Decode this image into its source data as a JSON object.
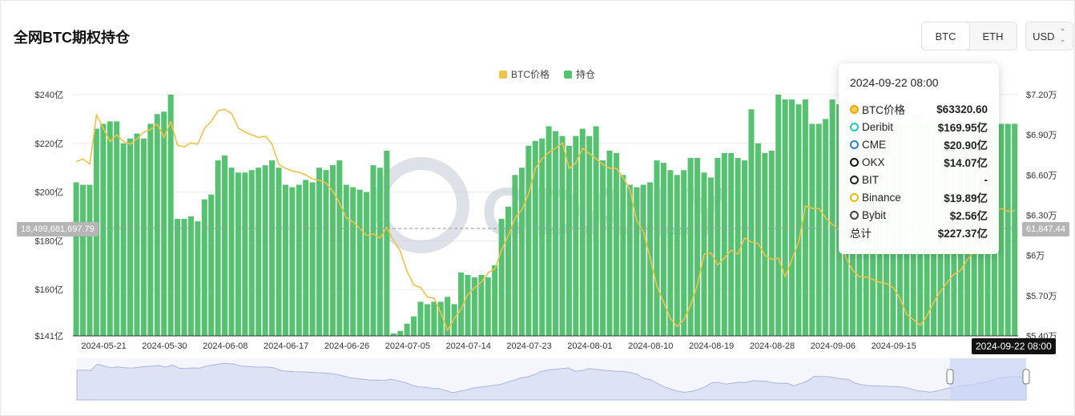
{
  "header": {
    "title": "全网BTC期权持仓",
    "tabs": [
      {
        "label": "BTC",
        "active": true
      },
      {
        "label": "ETH",
        "active": false
      }
    ],
    "currency": "USD",
    "currency_caret": "⌃⌄"
  },
  "legend": [
    {
      "label": "BTC价格",
      "color": "#f0c247"
    },
    {
      "label": "持仓",
      "color": "#56c271"
    }
  ],
  "crosshair": {
    "left_value": "18,499,681,697.79",
    "right_value": "61,847.44",
    "date": "2024-09-22 08:00"
  },
  "tooltip": {
    "date": "2024-09-22 08:00",
    "rows": [
      {
        "icon": "btc-price-icon",
        "color": "#f0a500",
        "label": "BTC价格",
        "value": "$63320.60"
      },
      {
        "icon": "deribit-icon",
        "color": "#1fc7b6",
        "label": "Deribit",
        "value": "$169.95亿"
      },
      {
        "icon": "cme-icon",
        "color": "#2b7fd4",
        "label": "CME",
        "value": "$20.90亿"
      },
      {
        "icon": "okx-icon",
        "color": "#111111",
        "label": "OKX",
        "value": "$14.07亿"
      },
      {
        "icon": "bit-icon",
        "color": "#222222",
        "label": "BIT",
        "value": "-"
      },
      {
        "icon": "binance-icon",
        "color": "#f0b90b",
        "label": "Binance",
        "value": "$19.89亿"
      },
      {
        "icon": "bybit-icon",
        "color": "#444444",
        "label": "Bybit",
        "value": "$2.56亿"
      },
      {
        "icon": "",
        "color": "",
        "label": "总计",
        "value": "$227.37亿"
      }
    ]
  },
  "watermark": "ODAILY",
  "chart_data": {
    "type": "bar",
    "title": "全网BTC期权持仓",
    "x_tick_labels": [
      "2024-05-21",
      "2024-05-30",
      "2024-06-08",
      "2024-06-17",
      "2024-06-26",
      "2024-07-05",
      "2024-07-14",
      "2024-07-23",
      "2024-08-01",
      "2024-08-10",
      "2024-08-19",
      "2024-08-28",
      "2024-09-06",
      "2024-09-15"
    ],
    "y_left_ticks": [
      "$141亿",
      "$160亿",
      "$180亿",
      "$200亿",
      "$220亿",
      "$240亿"
    ],
    "y_left_range": [
      141,
      240
    ],
    "y_right_ticks": [
      "$5.40万",
      "$5.70万",
      "$6万",
      "$6.30万",
      "$6.60万",
      "$6.90万",
      "$7.20万"
    ],
    "y_right_range": [
      54000,
      72000
    ],
    "series": [
      {
        "name": "持仓",
        "type": "bar",
        "color": "#56c271",
        "values": [
          204,
          203,
          203,
          226,
          228,
          229,
          229,
          220,
          222,
          224,
          222,
          228,
          232,
          233,
          240,
          189,
          189,
          190,
          188,
          197,
          199,
          213,
          215,
          210,
          208,
          208,
          209,
          210,
          211,
          213,
          210,
          203,
          202,
          203,
          205,
          204,
          210,
          209,
          211,
          213,
          203,
          202,
          201,
          200,
          211,
          210,
          217,
          142,
          143,
          146,
          149,
          155,
          154,
          155,
          155,
          157,
          154,
          167,
          166,
          165,
          166,
          165,
          170,
          189,
          194,
          207,
          210,
          219,
          221,
          222,
          227,
          225,
          223,
          219,
          223,
          226,
          223,
          227,
          213,
          217,
          216,
          207,
          203,
          202,
          203,
          204,
          213,
          212,
          209,
          207,
          209,
          214,
          214,
          208,
          206,
          214,
          216,
          216,
          214,
          213,
          234,
          220,
          216,
          217,
          240,
          238,
          238,
          236,
          238,
          228,
          228,
          230,
          238,
          236,
          238,
          225,
          225,
          228,
          230,
          226,
          229,
          231,
          228,
          228,
          232,
          232,
          228,
          230,
          232,
          228,
          226,
          229,
          230,
          234,
          228,
          228,
          228,
          228,
          228,
          228
        ]
      },
      {
        "name": "BTC价格",
        "type": "line",
        "color": "#f0c247",
        "values": [
          67000,
          67200,
          66800,
          70500,
          69500,
          68500,
          69000,
          68500,
          68300,
          68700,
          69200,
          69400,
          69800,
          68800,
          70000,
          68200,
          68100,
          68400,
          68300,
          69500,
          70000,
          70800,
          70900,
          70600,
          69500,
          69200,
          69000,
          68800,
          68900,
          68300,
          66800,
          66500,
          66300,
          66200,
          66000,
          65700,
          65600,
          65400,
          64800,
          63900,
          62800,
          62500,
          62000,
          61500,
          61600,
          61300,
          62100,
          61100,
          60300,
          58800,
          57800,
          57600,
          56900,
          56800,
          55700,
          54400,
          55300,
          56000,
          57100,
          57600,
          58000,
          58700,
          59000,
          60400,
          61500,
          62800,
          63400,
          64600,
          66500,
          67200,
          67700,
          68000,
          68400,
          66500,
          66900,
          68000,
          67600,
          67200,
          66800,
          66500,
          66500,
          65800,
          64900,
          62600,
          61800,
          59800,
          57700,
          56500,
          55300,
          54700,
          55200,
          56300,
          57800,
          60100,
          60200,
          59300,
          59800,
          60400,
          60100,
          61300,
          61000,
          60900,
          60000,
          59700,
          59800,
          58400,
          59700,
          61000,
          63700,
          63500,
          63500,
          62800,
          62300,
          61900,
          59800,
          58900,
          58400,
          58400,
          58200,
          58000,
          57900,
          57600,
          56800,
          55600,
          55200,
          54800,
          55500,
          56500,
          57300,
          58000,
          58600,
          58900,
          59700,
          60300,
          61500,
          62800,
          63200,
          63500,
          63300,
          63320
        ]
      }
    ],
    "bar_color": "#56c271",
    "line_color": "#f0c247",
    "grid": true,
    "legend_position": "top-center",
    "mini_navigator": true
  }
}
